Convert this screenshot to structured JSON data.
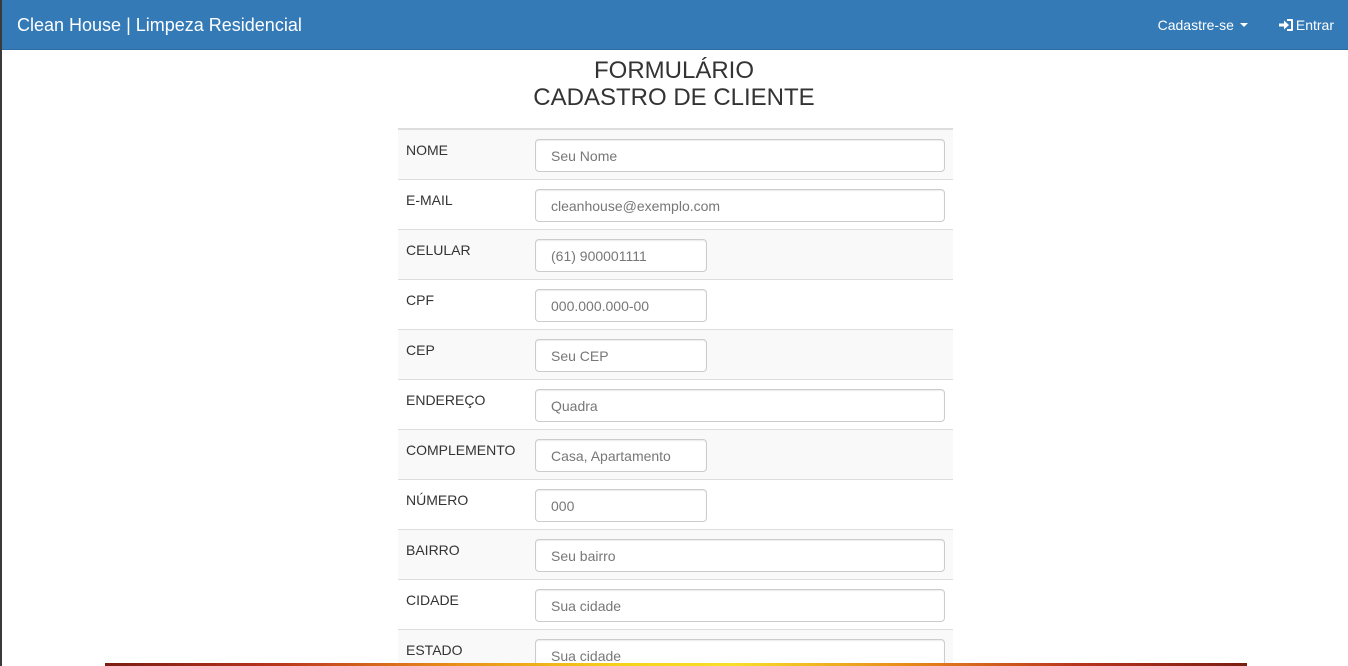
{
  "navbar": {
    "brand": "Clean House | Limpeza Residencial",
    "register_label": "Cadastre-se",
    "login_label": "Entrar",
    "bg_color": "#337ab7"
  },
  "page": {
    "title_line1": "FORMULÁRIO",
    "title_line2": "CADASTRO DE CLIENTE"
  },
  "form": {
    "fields": [
      {
        "label": "NOME",
        "placeholder": "Seu Nome"
      },
      {
        "label": "E-MAIL",
        "placeholder": "cleanhouse@exemplo.com"
      },
      {
        "label": "CELULAR",
        "placeholder": "(61) 900001111"
      },
      {
        "label": "CPF",
        "placeholder": "000.000.000-00"
      },
      {
        "label": "CEP",
        "placeholder": "Seu CEP"
      },
      {
        "label": "ENDEREÇO",
        "placeholder": "Quadra"
      },
      {
        "label": "COMPLEMENTO",
        "placeholder": "Casa, Apartamento"
      },
      {
        "label": "NÚMERO",
        "placeholder": "000"
      },
      {
        "label": "BAIRRO",
        "placeholder": "Seu bairro"
      },
      {
        "label": "CIDADE",
        "placeholder": "Sua cidade"
      },
      {
        "label": "ESTADO",
        "placeholder": "Sua cidade"
      }
    ]
  },
  "icons": {
    "register_caret": "caret-down-icon",
    "login": "log-in-icon"
  }
}
